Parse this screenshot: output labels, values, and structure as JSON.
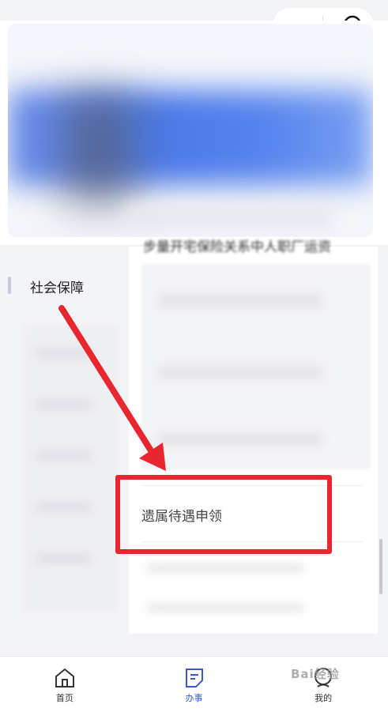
{
  "capsule": {
    "more_icon": "more-dots-icon",
    "close_icon": "target-close-icon"
  },
  "category": {
    "label": "社会保障"
  },
  "service": {
    "blurred_title": "步量开宅保险关系中人职厂运资",
    "highlighted_item": "遗属待遇申领"
  },
  "nav": {
    "items": [
      {
        "label": "首页",
        "icon": "home-icon"
      },
      {
        "label": "办事",
        "icon": "tasks-icon"
      },
      {
        "label": "我的",
        "icon": "profile-icon"
      }
    ],
    "active_index": 1,
    "active_color": "#3a5bc7"
  },
  "annotation": {
    "color": "#e8262f"
  },
  "watermark": {
    "text": "Bai经验"
  }
}
